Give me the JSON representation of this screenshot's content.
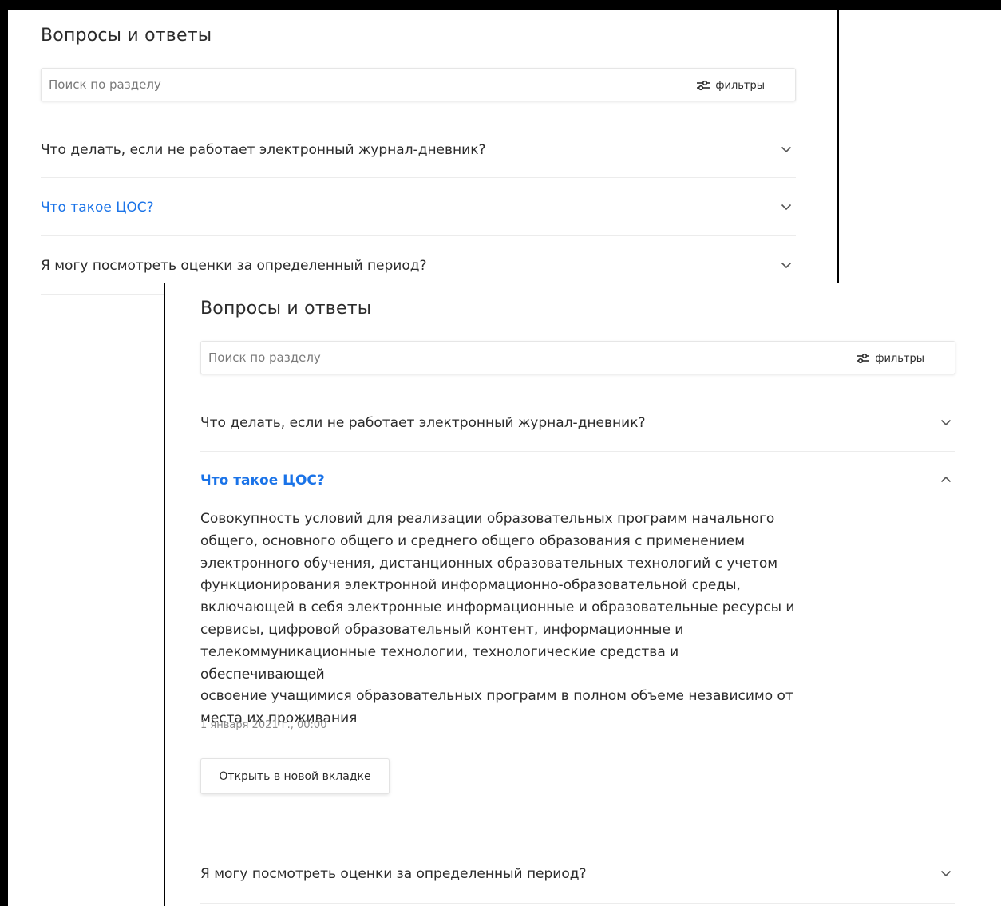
{
  "back_panel": {
    "title": "Вопросы и ответы",
    "search": {
      "placeholder": "Поиск по разделу",
      "filter_label": "фильтры"
    },
    "questions": [
      {
        "text": "Что делать, если не работает электронный журнал-дневник?",
        "state": "collapsed"
      },
      {
        "text": "Что такое ЦОС?",
        "state": "collapsed",
        "highlighted": true
      },
      {
        "text": "Я могу посмотреть оценки за определенный период?",
        "state": "collapsed"
      }
    ]
  },
  "front_panel": {
    "title": "Вопросы и ответы",
    "search": {
      "placeholder": "Поиск по разделу",
      "filter_label": "фильтры"
    },
    "questions": [
      {
        "text": "Что делать, если не работает электронный журнал-дневник?",
        "state": "collapsed"
      },
      {
        "text": "Что такое ЦОС?",
        "state": "expanded",
        "answer_lines": [
          "Совокупность условий для реализации образовательных программ начального",
          "общего, основного общего и среднего общего образования с применением",
          "электронного обучения, дистанционных образовательных технологий с учетом",
          "функционирования электронной информационно-образовательной среды,",
          "включающей в себя электронные информационные и образовательные ресурсы и",
          "сервисы, цифровой образовательный контент, информационные и",
          "телекоммуникационные технологии, технологические средства и обеспечивающей",
          "освоение учащимися образовательных программ в полном объеме независимо от",
          "места их проживания"
        ],
        "date": "1 января 2021 г., 00:00",
        "open_button": "Открыть в новой вкладке"
      },
      {
        "text": "Я могу посмотреть оценки за определенный период?",
        "state": "collapsed"
      }
    ]
  },
  "colors": {
    "link": "#1a73e8",
    "text": "#2b2b2b",
    "muted": "#8a8a8a",
    "frame": "#000000"
  },
  "icons": {
    "filter": "sliders-icon",
    "expand": "chevron-down-icon",
    "collapse": "chevron-up-icon"
  }
}
